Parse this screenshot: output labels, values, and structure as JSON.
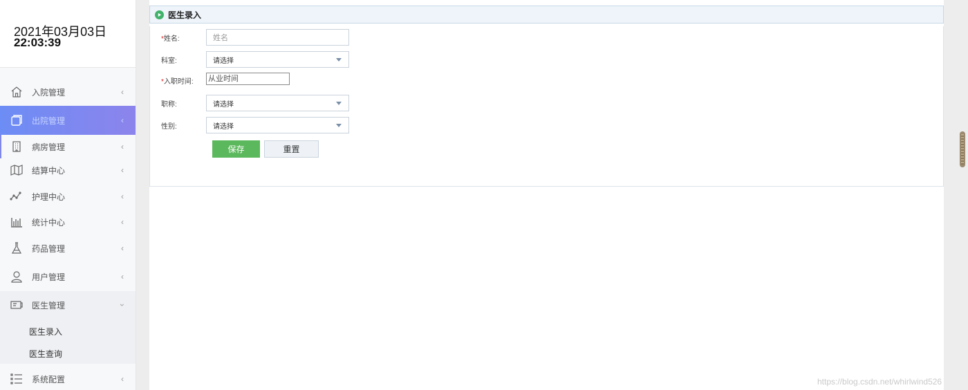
{
  "clock": {
    "date": "2021年03月03日",
    "time": "22:03:39"
  },
  "sidebar": {
    "items": [
      {
        "label": "入院管理",
        "icon": "home-icon",
        "chevron": "‹"
      },
      {
        "label": "出院管理",
        "icon": "window-icon",
        "chevron": "‹"
      },
      {
        "label": "病房管理",
        "icon": "building-icon",
        "chevron": "‹"
      },
      {
        "label": "结算中心",
        "icon": "map-icon",
        "chevron": "‹"
      },
      {
        "label": "护理中心",
        "icon": "line-chart-icon",
        "chevron": "‹"
      },
      {
        "label": "统计中心",
        "icon": "bar-chart-icon",
        "chevron": "‹"
      },
      {
        "label": "药品管理",
        "icon": "flask-icon",
        "chevron": "‹"
      },
      {
        "label": "用户管理",
        "icon": "user-icon",
        "chevron": "‹"
      },
      {
        "label": "医生管理",
        "icon": "id-card-icon",
        "chevron": "›"
      },
      {
        "label": "系统配置",
        "icon": "list-icon",
        "chevron": "‹"
      }
    ],
    "sub_items": [
      {
        "label": "医生录入"
      },
      {
        "label": "医生查询"
      }
    ]
  },
  "panel": {
    "title": "医生录入"
  },
  "form": {
    "name_label": "姓名:",
    "name_placeholder": "姓名",
    "dept_label": "科室:",
    "dept_value": "请选择",
    "hire_label": "入职时间:",
    "hire_placeholder": "从业时间",
    "title_label": "职称:",
    "title_value": "请选择",
    "gender_label": "性别:",
    "gender_value": "请选择",
    "required_mark": "*",
    "save_label": "保存",
    "reset_label": "重置"
  },
  "watermark": "https://blog.csdn.net/whirlwind526",
  "colors": {
    "active_gradient_start": "#6c8df5",
    "active_gradient_end": "#8c84ec",
    "save_button": "#5cb85c",
    "panel_dot": "#41b26a"
  }
}
